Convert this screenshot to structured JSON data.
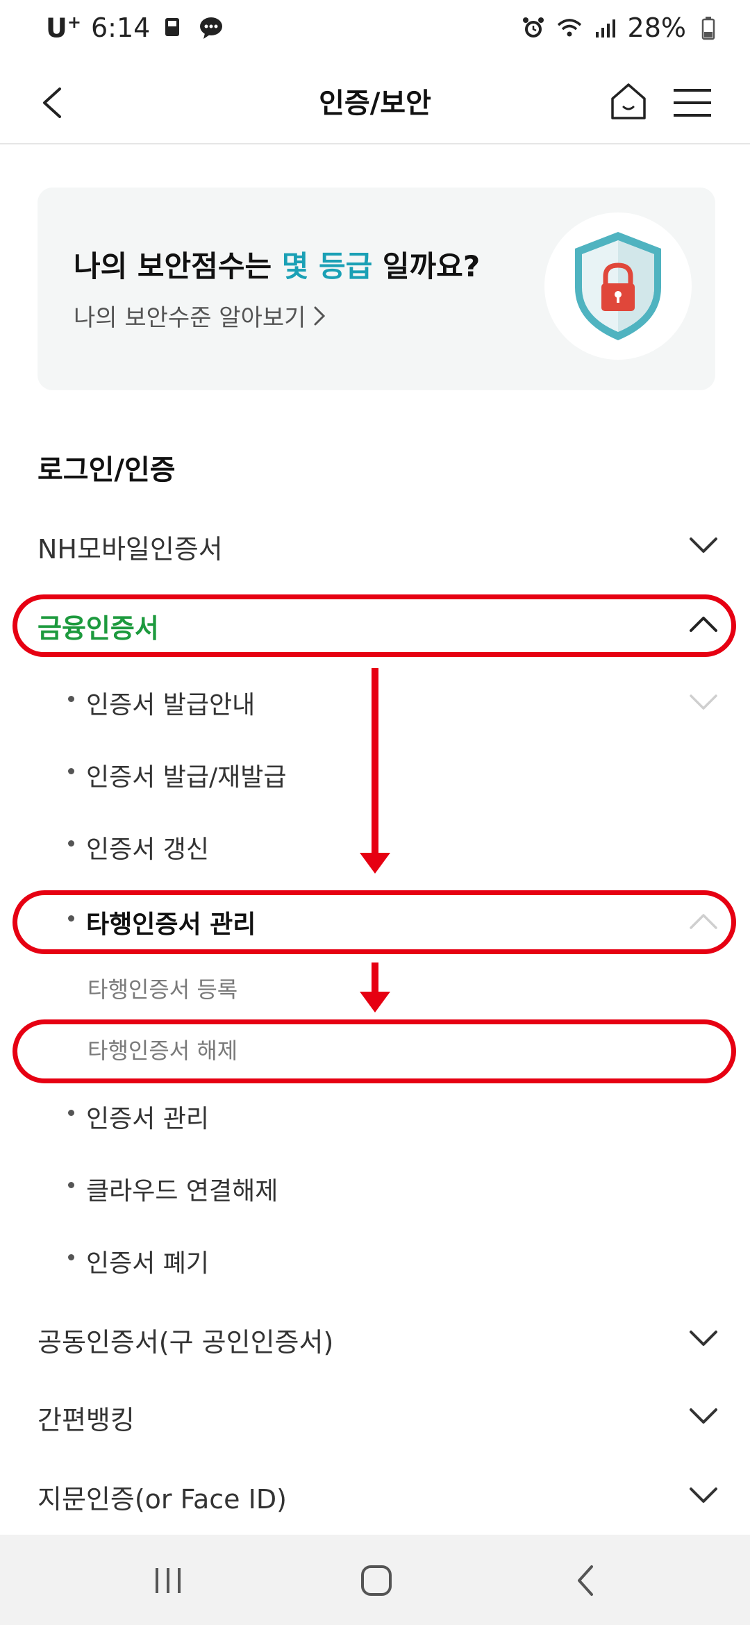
{
  "status_bar": {
    "carrier": "U",
    "carrier_sup": "+",
    "time": "6:14",
    "battery": "28%"
  },
  "header": {
    "title": "인증/보안"
  },
  "banner": {
    "title_before": "나의 보안점수는 ",
    "title_accent": "몇 등급",
    "title_after": " 일까요?",
    "link": "나의 보안수준 알아보기",
    "accent_color": "#1aa0b5"
  },
  "section": {
    "title": "로그인/인증"
  },
  "menu": {
    "nh_mobile": "NH모바일인증서",
    "financial": "금융인증서",
    "financial_sub": [
      "인증서 발급안내",
      "인증서 발급/재발급",
      "인증서 갱신",
      "타행인증서 관리"
    ],
    "other_bank_sub": [
      "타행인증서 등록",
      "타행인증서 해제"
    ],
    "financial_sub_after": [
      "인증서 관리",
      "클라우드 연결해제",
      "인증서 폐기"
    ],
    "joint": "공동인증서(구 공인인증서)",
    "simple_banking": "간편뱅킹",
    "fingerprint": "지문인증(or Face ID)"
  },
  "colors": {
    "active_green": "#1d9a3e",
    "annotation_red": "#e60012"
  },
  "icons": {
    "back": "back-chevron-icon",
    "home": "home-icon",
    "menu": "hamburger-menu-icon",
    "shield": "security-shield-icon"
  }
}
